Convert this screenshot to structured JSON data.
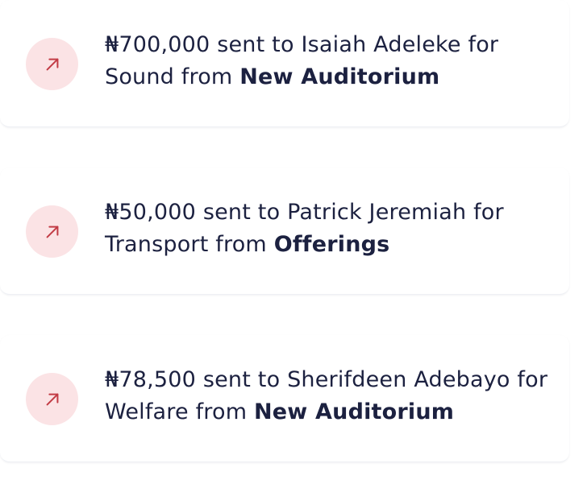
{
  "colors": {
    "icon_bg": "#fbe3e5",
    "icon_fg": "#c23b45",
    "text": "#1c2140"
  },
  "transactions": [
    {
      "icon": "arrow-up-right-icon",
      "amount": "₦700,000",
      "middle": " sent to Isaiah Adeleke for Sound from ",
      "source": "New Auditorium"
    },
    {
      "icon": "arrow-up-right-icon",
      "amount": "₦50,000",
      "middle": " sent to Patrick Jeremiah for Transport from ",
      "source": "Offerings"
    },
    {
      "icon": "arrow-up-right-icon",
      "amount": "₦78,500",
      "middle": " sent to Sherifdeen Adebayo for Welfare from ",
      "source": "New Auditorium"
    }
  ]
}
